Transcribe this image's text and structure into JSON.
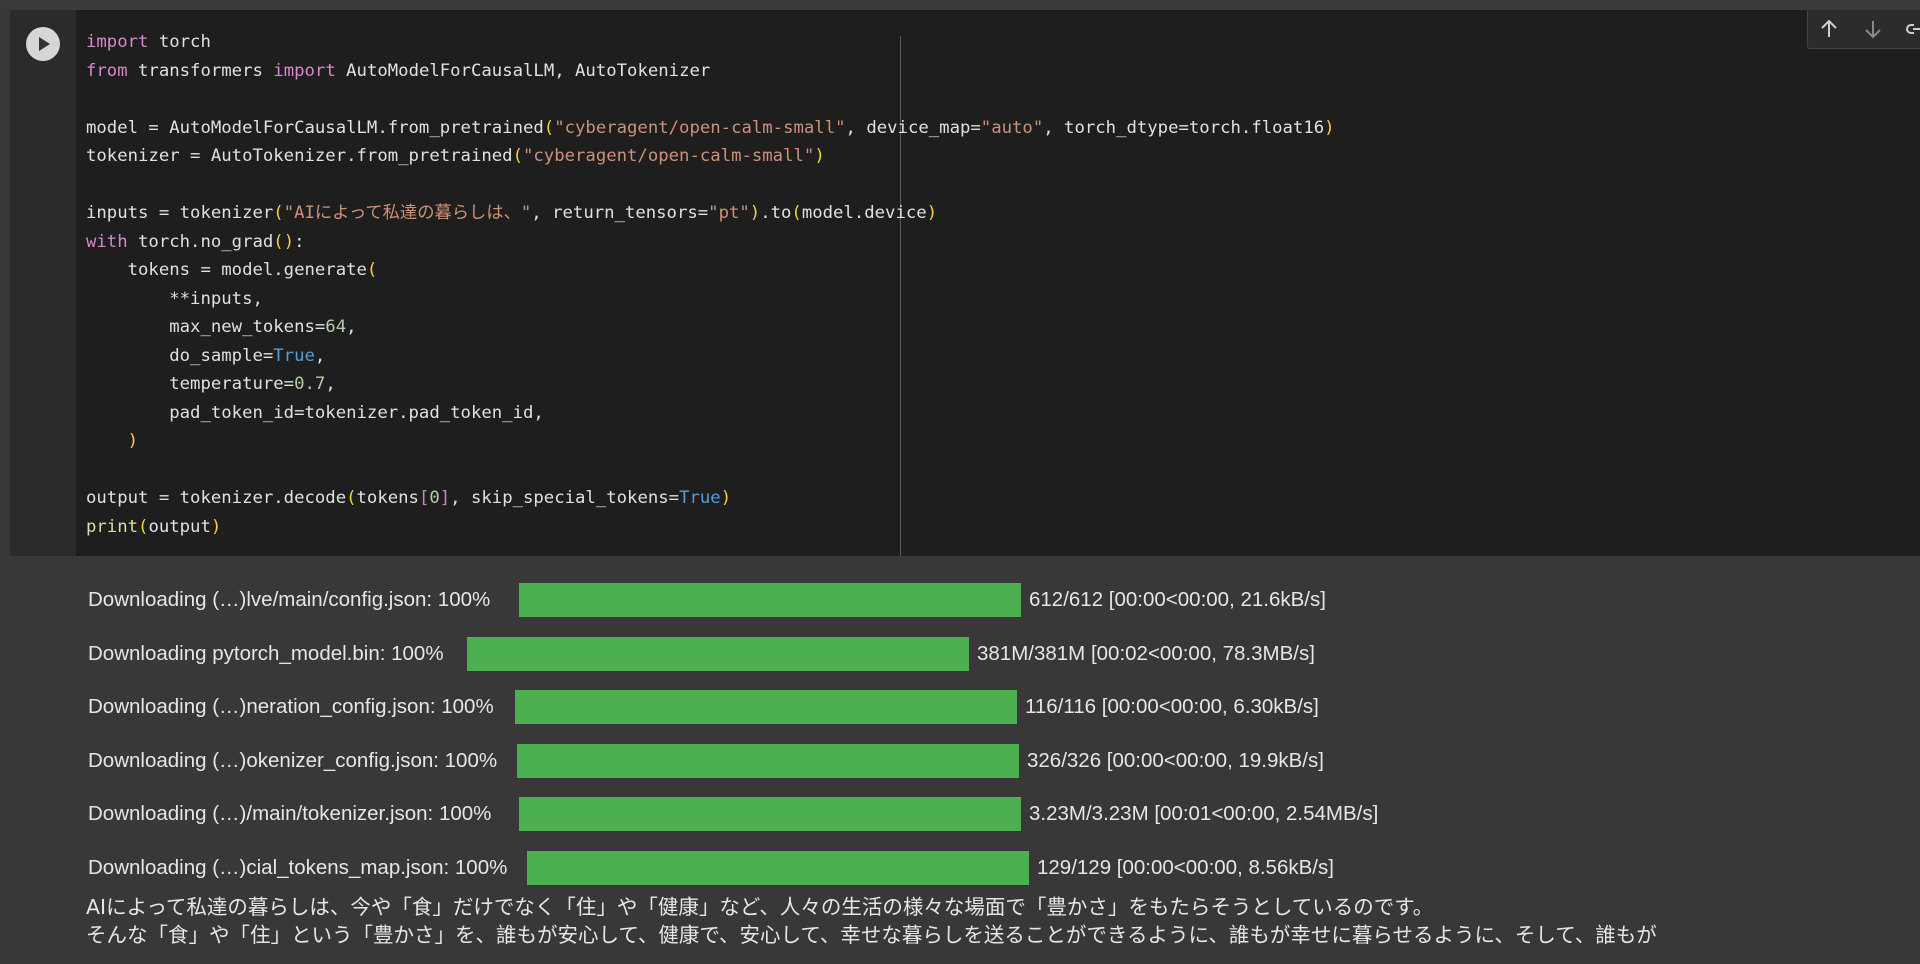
{
  "cell": {
    "code_lines": [
      [
        {
          "t": "import",
          "c": "kw"
        },
        {
          "t": " torch",
          "c": "plain"
        }
      ],
      [
        {
          "t": "from",
          "c": "kw"
        },
        {
          "t": " transformers ",
          "c": "plain"
        },
        {
          "t": "import",
          "c": "kw"
        },
        {
          "t": " AutoModelForCausalLM, AutoTokenizer",
          "c": "plain"
        }
      ],
      [],
      [
        {
          "t": "model = AutoModelForCausalLM.from_pretrained",
          "c": "plain"
        },
        {
          "t": "(",
          "c": "paren1"
        },
        {
          "t": "\"cyberagent/open-calm-small\"",
          "c": "str"
        },
        {
          "t": ", device_map=",
          "c": "plain"
        },
        {
          "t": "\"auto\"",
          "c": "str"
        },
        {
          "t": ", torch_dtype=torch.float16",
          "c": "plain"
        },
        {
          "t": ")",
          "c": "paren1"
        }
      ],
      [
        {
          "t": "tokenizer = AutoTokenizer.from_pretrained",
          "c": "plain"
        },
        {
          "t": "(",
          "c": "paren1"
        },
        {
          "t": "\"cyberagent/open-calm-small\"",
          "c": "str"
        },
        {
          "t": ")",
          "c": "paren1"
        }
      ],
      [],
      [
        {
          "t": "inputs = tokenizer",
          "c": "plain"
        },
        {
          "t": "(",
          "c": "paren1"
        },
        {
          "t": "\"AIによって私達の暮らしは、\"",
          "c": "str"
        },
        {
          "t": ", return_tensors=",
          "c": "plain"
        },
        {
          "t": "\"pt\"",
          "c": "str"
        },
        {
          "t": ")",
          "c": "paren1"
        },
        {
          "t": ".to",
          "c": "plain"
        },
        {
          "t": "(",
          "c": "paren1"
        },
        {
          "t": "model.device",
          "c": "plain"
        },
        {
          "t": ")",
          "c": "paren1"
        }
      ],
      [
        {
          "t": "with",
          "c": "kw"
        },
        {
          "t": " torch.no_grad",
          "c": "plain"
        },
        {
          "t": "()",
          "c": "paren1"
        },
        {
          "t": ":",
          "c": "plain"
        }
      ],
      [
        {
          "t": "    tokens = model.generate",
          "c": "plain"
        },
        {
          "t": "(",
          "c": "paren1"
        }
      ],
      [
        {
          "t": "        **inputs,",
          "c": "plain"
        }
      ],
      [
        {
          "t": "        max_new_tokens=",
          "c": "plain"
        },
        {
          "t": "64",
          "c": "num"
        },
        {
          "t": ",",
          "c": "plain"
        }
      ],
      [
        {
          "t": "        do_sample=",
          "c": "plain"
        },
        {
          "t": "True",
          "c": "bool"
        },
        {
          "t": ",",
          "c": "plain"
        }
      ],
      [
        {
          "t": "        temperature=",
          "c": "plain"
        },
        {
          "t": "0.7",
          "c": "num"
        },
        {
          "t": ",",
          "c": "plain"
        }
      ],
      [
        {
          "t": "        pad_token_id=tokenizer.pad_token_id,",
          "c": "plain"
        }
      ],
      [
        {
          "t": "    ",
          "c": "plain"
        },
        {
          "t": ")",
          "c": "paren1"
        }
      ],
      [],
      [
        {
          "t": "output = tokenizer.decode",
          "c": "plain"
        },
        {
          "t": "(",
          "c": "paren1"
        },
        {
          "t": "tokens",
          "c": "plain"
        },
        {
          "t": "[",
          "c": "paren2"
        },
        {
          "t": "0",
          "c": "num"
        },
        {
          "t": "]",
          "c": "paren2"
        },
        {
          "t": ", skip_special_tokens=",
          "c": "plain"
        },
        {
          "t": "True",
          "c": "bool"
        },
        {
          "t": ")",
          "c": "paren1"
        }
      ],
      [
        {
          "t": "print",
          "c": "fn"
        },
        {
          "t": "(",
          "c": "paren1"
        },
        {
          "t": "output",
          "c": "plain"
        },
        {
          "t": ")",
          "c": "paren1"
        }
      ]
    ]
  },
  "toolbar": {
    "move_up_icon": "arrow-up",
    "move_down_icon": "arrow-down",
    "link_icon": "link"
  },
  "downloads": [
    {
      "label": "Downloading (…)lve/main/config.json: 100%",
      "progress": 1.0,
      "stats": "612/612 [00:00<00:00, 21.6kB/s]"
    },
    {
      "label": "Downloading pytorch_model.bin: 100%",
      "progress": 1.0,
      "stats": "381M/381M [00:02<00:00, 78.3MB/s]"
    },
    {
      "label": "Downloading (…)neration_config.json: 100%",
      "progress": 1.0,
      "stats": "116/116 [00:00<00:00, 6.30kB/s]"
    },
    {
      "label": "Downloading (…)okenizer_config.json: 100%",
      "progress": 1.0,
      "stats": "326/326 [00:00<00:00, 19.9kB/s]"
    },
    {
      "label": "Downloading (…)/main/tokenizer.json: 100%",
      "progress": 1.0,
      "stats": "3.23M/3.23M [00:01<00:00, 2.54MB/s]"
    },
    {
      "label": "Downloading (…)cial_tokens_map.json: 100%",
      "progress": 1.0,
      "stats": "129/129 [00:00<00:00, 8.56kB/s]"
    }
  ],
  "generated_output": [
    "AIによって私達の暮らしは、今や「食」だけでなく「住」や「健康」など、人々の生活の様々な場面で「豊かさ」をもたらそうとしているのです。",
    "そんな「食」や「住」という「豊かさ」を、誰もが安心して、健康で、安心して、幸せな暮らしを送ることができるように、誰もが幸せに暮らせるように、そして、誰もが"
  ],
  "colors": {
    "progress_fill": "#4caf50",
    "background": "#383838",
    "editor_bg": "#1e1e1e"
  }
}
